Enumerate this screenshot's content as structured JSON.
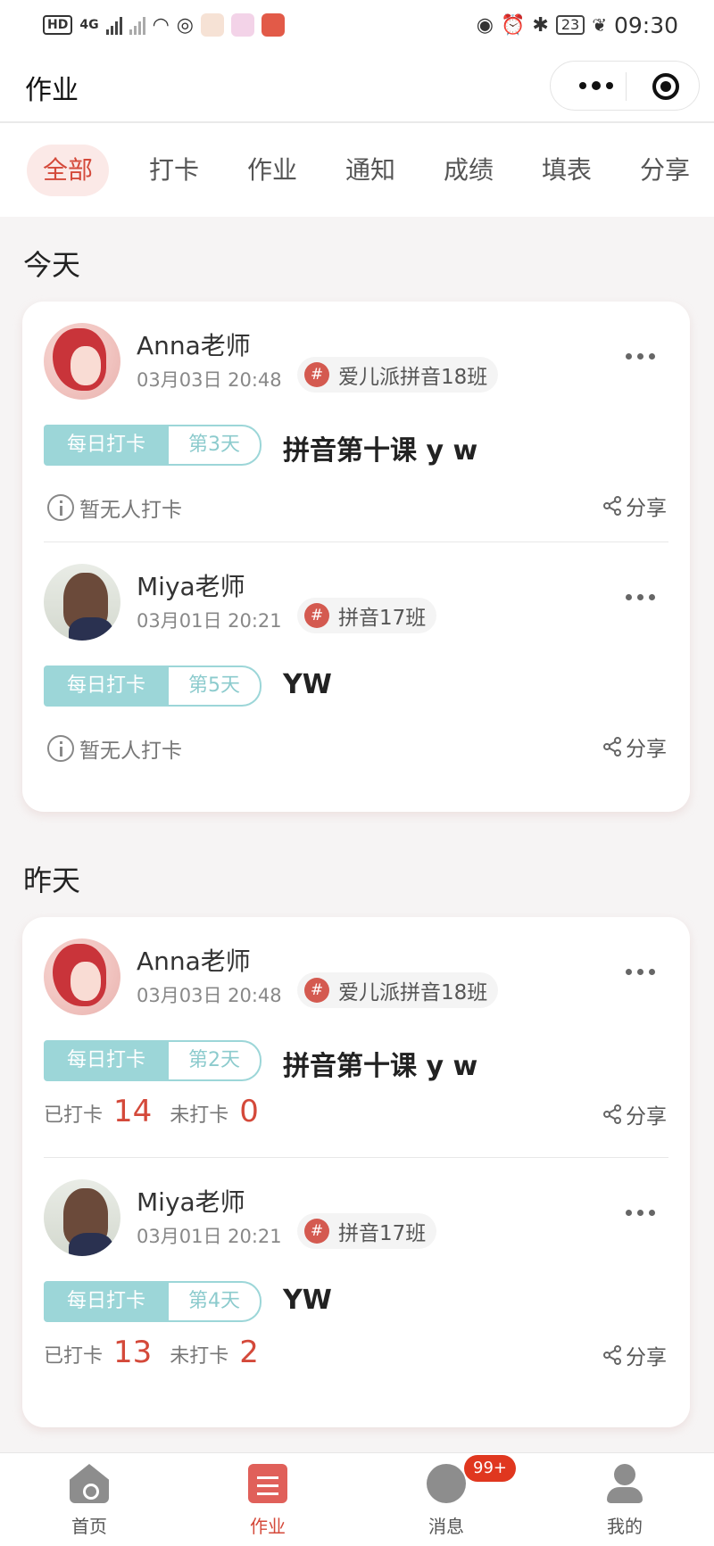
{
  "status_bar": {
    "hd": "HD",
    "network": "4G",
    "battery": "23",
    "time": "09:30"
  },
  "header": {
    "title": "作业"
  },
  "tabs": [
    {
      "label": "全部",
      "active": true
    },
    {
      "label": "打卡"
    },
    {
      "label": "作业"
    },
    {
      "label": "通知"
    },
    {
      "label": "成绩"
    },
    {
      "label": "填表"
    },
    {
      "label": "分享"
    }
  ],
  "sections": [
    {
      "title": "今天",
      "items": [
        {
          "teacher": "Anna老师",
          "time": "03月03日 20:48",
          "class": "爱儿派拼音18班",
          "badge": "每日打卡",
          "day": "第3天",
          "task": "拼音第十课 y w",
          "status": "暂无人打卡",
          "share": "分享"
        },
        {
          "teacher": "Miya老师",
          "time": "03月01日 20:21",
          "class": "拼音17班",
          "badge": "每日打卡",
          "day": "第5天",
          "task": "YW",
          "status": "暂无人打卡",
          "share": "分享"
        }
      ]
    },
    {
      "title": "昨天",
      "items": [
        {
          "teacher": "Anna老师",
          "time": "03月03日 20:48",
          "class": "爱儿派拼音18班",
          "badge": "每日打卡",
          "day": "第2天",
          "task": "拼音第十课 y w",
          "done_label": "已打卡",
          "done": "14",
          "undone_label": "未打卡",
          "undone": "0",
          "share": "分享"
        },
        {
          "teacher": "Miya老师",
          "time": "03月01日 20:21",
          "class": "拼音17班",
          "badge": "每日打卡",
          "day": "第4天",
          "task": "YW",
          "done_label": "已打卡",
          "done": "13",
          "undone_label": "未打卡",
          "undone": "2",
          "share": "分享"
        }
      ]
    }
  ],
  "tabbar": [
    {
      "label": "首页",
      "icon": "home-icon"
    },
    {
      "label": "作业",
      "icon": "homework-icon",
      "active": true
    },
    {
      "label": "消息",
      "icon": "message-icon",
      "badge": "99+"
    },
    {
      "label": "我的",
      "icon": "profile-icon"
    }
  ],
  "colors": {
    "accent": "#d4493a",
    "teal": "#9cd6d8"
  }
}
